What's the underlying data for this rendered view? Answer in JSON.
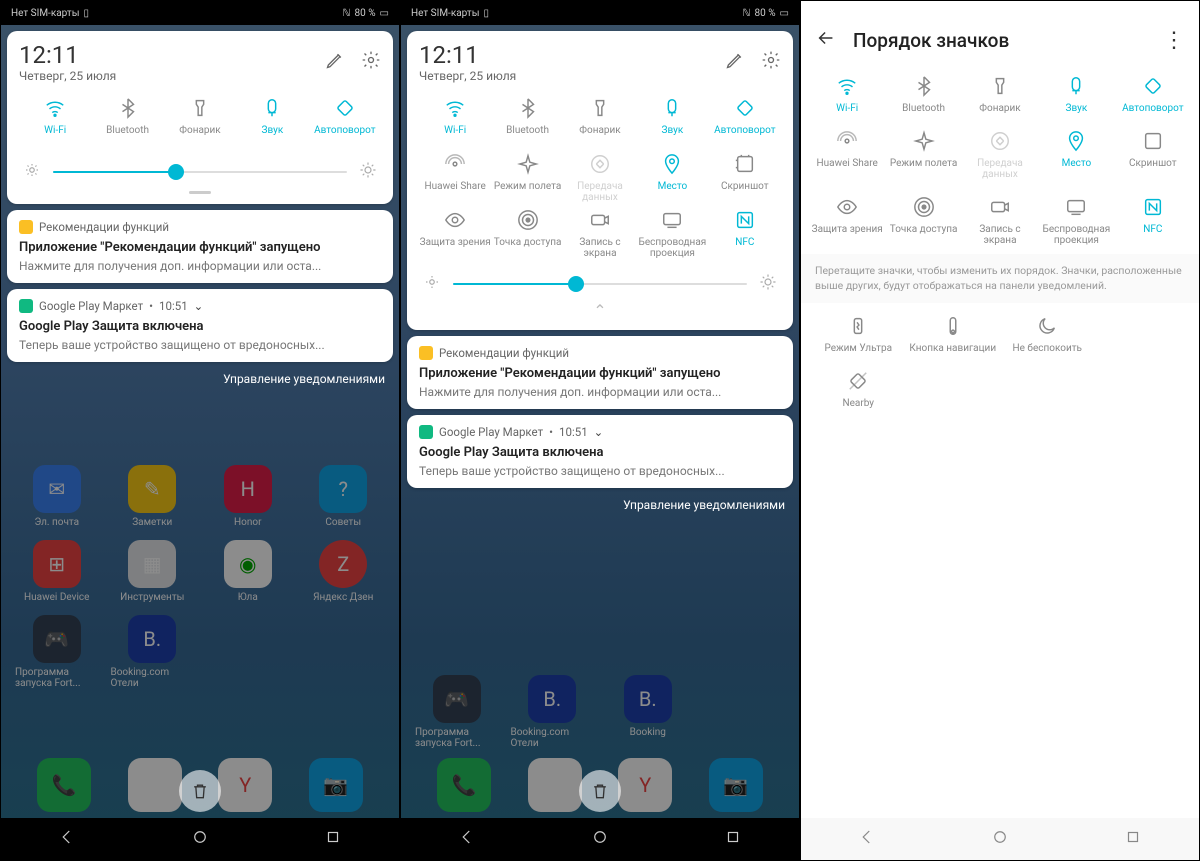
{
  "status": {
    "sim": "Нет SIM-карты",
    "battery": "80 %"
  },
  "header": {
    "time": "12:11",
    "date": "Четверг, 25 июля"
  },
  "qs": {
    "wifi": "Wi-Fi",
    "bluetooth": "Bluetooth",
    "flashlight": "Фонарик",
    "sound": "Звук",
    "autorotate": "Автоповорот",
    "huawei_share": "Huawei Share",
    "airplane": "Режим полета",
    "data": "Передача данных",
    "location": "Место",
    "screenshot": "Скриншот",
    "eye": "Защита зрения",
    "hotspot": "Точка доступа",
    "screenrec": "Запись с экрана",
    "cast": "Беспроводная проекция",
    "nfc": "NFC"
  },
  "notif1": {
    "app": "Рекомендации функций",
    "title": "Приложение \"Рекомендации функций\" запущено",
    "body": "Нажмите для получения доп. информации или оста..."
  },
  "notif2": {
    "app": "Google Play Маркет",
    "time": "10:51",
    "title": "Google Play Защита включена",
    "body": "Теперь ваше устройство защищено от вредоносных..."
  },
  "manage": "Управление уведомлениями",
  "home": {
    "email": "Эл. почта",
    "notes": "Заметки",
    "tips": "Советы",
    "huawei_device": "Huawei Device",
    "tools": "Инструменты",
    "youla": "Юла",
    "yandex_dzen": "Яндекс Дзен",
    "fortnite": "Программа запуска Fort...",
    "booking": "Booking.com Отели",
    "booking2": "Booking"
  },
  "p3": {
    "title": "Порядок значков",
    "hint": "Перетащите значки, чтобы изменить их порядок. Значки, расположенные выше других, будут отображаться на панели уведомлений.",
    "ultra": "Режим Ультра",
    "navbtn": "Кнопка навигации",
    "dnd": "Не беспокоить",
    "nearby": "Nearby"
  }
}
